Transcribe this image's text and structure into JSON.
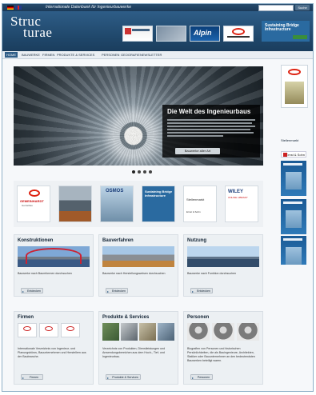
{
  "topbar": {
    "tagline": "Internationale Datenbank für Ingenieurbauwerke",
    "search_placeholder": "",
    "search_button": "Suche"
  },
  "header": {
    "logo_line1": "Struc",
    "logo_line2": "turae",
    "banners": [
      "Ernst & Sohn",
      "",
      "Alpin",
      "Ernst & Sohn"
    ],
    "sponsor_title": "Sustaining Bridge Infrastructure",
    "sponsor_brand": "Bentley"
  },
  "nav": {
    "items": [
      "HOME",
      "BAUWERKE",
      "FIRMEN",
      "PRODUKTE & SERVICES",
      "PERSONEN",
      "GEOGRAFIE",
      "NEWSLETTER"
    ],
    "active_index": 0
  },
  "hero": {
    "title": "Die Welt des Ingenieurbaus",
    "button": "Bauwerke aller Art",
    "slide_count": 4,
    "active_slide": 0
  },
  "right_column": {
    "stellenmarkt": "Stellenmarkt",
    "ernst_sohn": "Ernst & Sohn"
  },
  "logos": {
    "items": [
      {
        "line1": "GEMEINHARDT",
        "line2": "Gerüstbau"
      },
      {
        "line1": ""
      },
      {
        "line1": "OSMOS"
      },
      {
        "line1": "Sustaining Bridge Infrastructure"
      },
      {
        "line1": "Stellenmarkt",
        "line2": "Ernst & Sohn"
      },
      {
        "line1": "WILEY",
        "line2": "ONLINE LIBRARY"
      }
    ]
  },
  "cards": [
    {
      "title": "Konstruktionen",
      "desc": "Bauwerke nach Baumformen durchsuchen",
      "button": "Entdecken"
    },
    {
      "title": "Bauverfahren",
      "desc": "Bauwerke nach Herstellungsweisen durchsuchen",
      "button": "Entdecken"
    },
    {
      "title": "Nutzung",
      "desc": "Bauwerke nach Funktion durchsuchen",
      "button": "Entdecken"
    },
    {
      "title": "Firmen",
      "desc": "Internationale Verzeichnis von Ingenieur- und Planungsbüros, Bauunternehmen und Herstellern aus der Baubranche.",
      "button": "Firmen"
    },
    {
      "title": "Produkte & Services",
      "desc": "Verzeichnis von Produkten, Dienstleistungen und Anwendungsbereichen aus dem Hoch-, Tief- und Ingenieurbau.",
      "button": "Produkte & Services"
    },
    {
      "title": "Personen",
      "desc": "Biografien von Personen und historischen Persönlichkeiten, die als Bauingenieure, Architekten, Statiker oder Bauunternehmer an den bedeutendsten Bauwerken beteiligt waren.",
      "button": "Personen"
    }
  ]
}
